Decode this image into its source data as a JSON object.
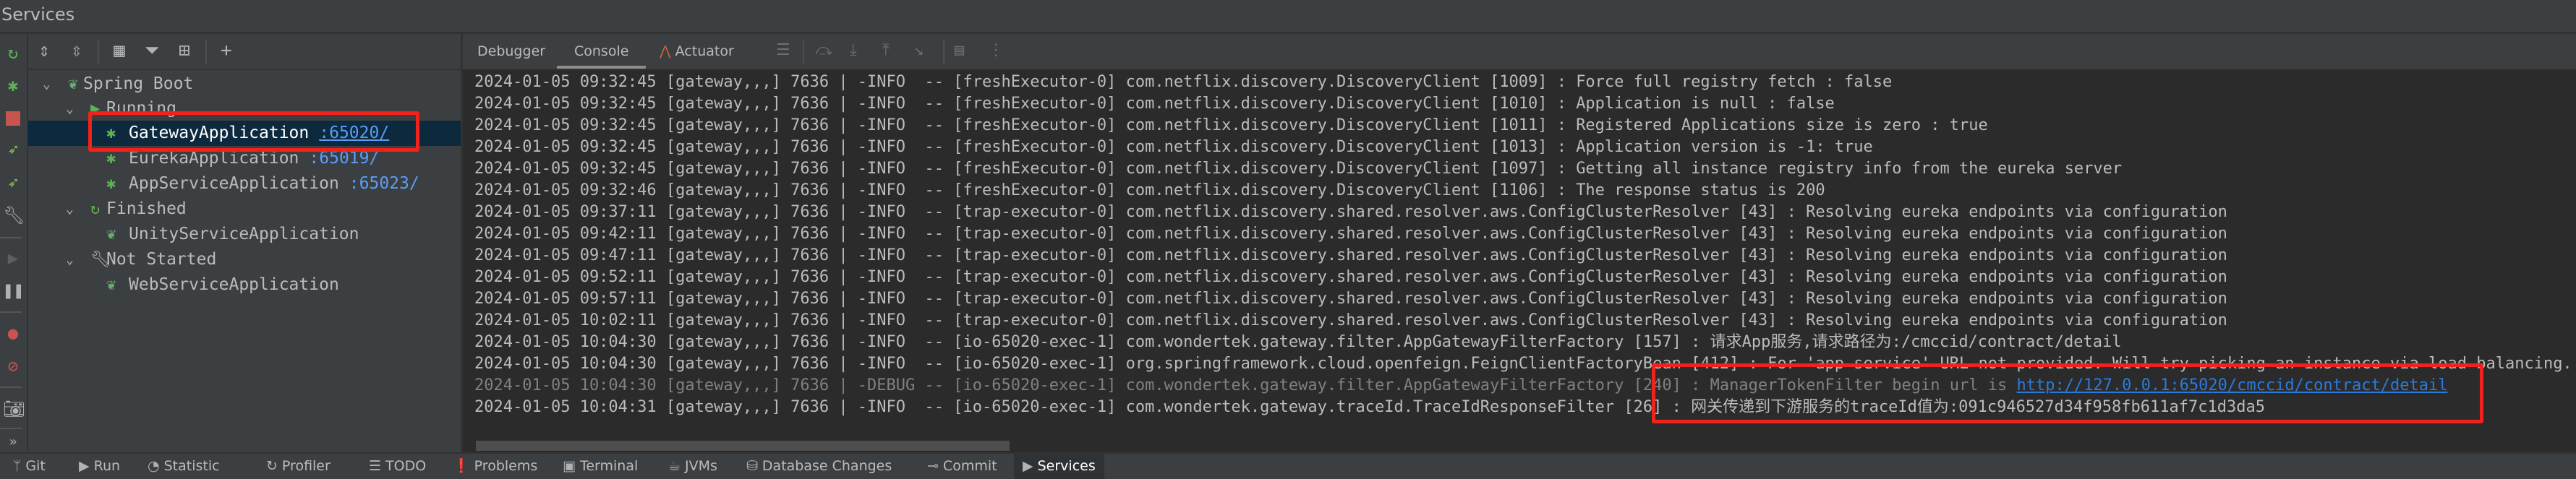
{
  "window": {
    "title": "Services"
  },
  "colors": {
    "accent_link": "#287bde",
    "port_link": "#589df6",
    "selection": "#0d293e",
    "highlight_box": "#f0221b",
    "run_green": "#5fb157",
    "stop_red": "#c75450"
  },
  "left_toolbar": {
    "icons": [
      "rerun-icon",
      "debug-icon",
      "stop-icon",
      "run-spring-icon",
      "debug-spring-icon",
      "wrench-icon",
      "resume-icon",
      "pause-icon",
      "breakpoints-icon",
      "mute-breakpoints-icon",
      "camera-icon",
      "more-icon"
    ],
    "more_label": "»"
  },
  "tree_toolbar": {
    "icons": [
      "expand-all-icon",
      "collapse-all-icon",
      "group-icon",
      "filter-icon",
      "new-tab-icon",
      "add-icon"
    ]
  },
  "tree": {
    "spring_boot": "Spring Boot",
    "running": "Running",
    "gateway": {
      "name": "GatewayApplication",
      "port": ":65020/"
    },
    "eureka": {
      "name": "EurekaApplication",
      "port": ":65019/"
    },
    "appservice": {
      "name": "AppServiceApplication",
      "port": ":65023/"
    },
    "finished": "Finished",
    "unity": "UnityServiceApplication",
    "not_started": "Not Started",
    "web": "WebServiceApplication"
  },
  "console_tabs": {
    "debugger": "Debugger",
    "console": "Console",
    "actuator": "Actuator",
    "active": "Console"
  },
  "log_lines": [
    {
      "text": "2024-01-05 09:32:45 [gateway,,,] 7636 | -INFO  -- [freshExecutor-0] com.netflix.discovery.DiscoveryClient [1009] : Force full registry fetch : false",
      "level": "INFO"
    },
    {
      "text": "2024-01-05 09:32:45 [gateway,,,] 7636 | -INFO  -- [freshExecutor-0] com.netflix.discovery.DiscoveryClient [1010] : Application is null : false",
      "level": "INFO"
    },
    {
      "text": "2024-01-05 09:32:45 [gateway,,,] 7636 | -INFO  -- [freshExecutor-0] com.netflix.discovery.DiscoveryClient [1011] : Registered Applications size is zero : true",
      "level": "INFO"
    },
    {
      "text": "2024-01-05 09:32:45 [gateway,,,] 7636 | -INFO  -- [freshExecutor-0] com.netflix.discovery.DiscoveryClient [1013] : Application version is -1: true",
      "level": "INFO"
    },
    {
      "text": "2024-01-05 09:32:45 [gateway,,,] 7636 | -INFO  -- [freshExecutor-0] com.netflix.discovery.DiscoveryClient [1097] : Getting all instance registry info from the eureka server",
      "level": "INFO"
    },
    {
      "text": "2024-01-05 09:32:46 [gateway,,,] 7636 | -INFO  -- [freshExecutor-0] com.netflix.discovery.DiscoveryClient [1106] : The response status is 200",
      "level": "INFO"
    },
    {
      "text": "2024-01-05 09:37:11 [gateway,,,] 7636 | -INFO  -- [trap-executor-0] com.netflix.discovery.shared.resolver.aws.ConfigClusterResolver [43] : Resolving eureka endpoints via configuration",
      "level": "INFO"
    },
    {
      "text": "2024-01-05 09:42:11 [gateway,,,] 7636 | -INFO  -- [trap-executor-0] com.netflix.discovery.shared.resolver.aws.ConfigClusterResolver [43] : Resolving eureka endpoints via configuration",
      "level": "INFO"
    },
    {
      "text": "2024-01-05 09:47:11 [gateway,,,] 7636 | -INFO  -- [trap-executor-0] com.netflix.discovery.shared.resolver.aws.ConfigClusterResolver [43] : Resolving eureka endpoints via configuration",
      "level": "INFO"
    },
    {
      "text": "2024-01-05 09:52:11 [gateway,,,] 7636 | -INFO  -- [trap-executor-0] com.netflix.discovery.shared.resolver.aws.ConfigClusterResolver [43] : Resolving eureka endpoints via configuration",
      "level": "INFO"
    },
    {
      "text": "2024-01-05 09:57:11 [gateway,,,] 7636 | -INFO  -- [trap-executor-0] com.netflix.discovery.shared.resolver.aws.ConfigClusterResolver [43] : Resolving eureka endpoints via configuration",
      "level": "INFO"
    },
    {
      "text": "2024-01-05 10:02:11 [gateway,,,] 7636 | -INFO  -- [trap-executor-0] com.netflix.discovery.shared.resolver.aws.ConfigClusterResolver [43] : Resolving eureka endpoints via configuration",
      "level": "INFO"
    },
    {
      "text": "2024-01-05 10:04:30 [gateway,,,] 7636 | -INFO  -- [io-65020-exec-1] com.wondertek.gateway.filter.AppGatewayFilterFactory [157] : 请求App服务,请求路径为:/cmccid/contract/detail",
      "level": "INFO"
    },
    {
      "text": "2024-01-05 10:04:30 [gateway,,,] 7636 | -INFO  -- [io-65020-exec-1] org.springframework.cloud.openfeign.FeignClientFactoryBean [412] : For 'app-service' URL not provided. Will try picking an instance via load-balancing.",
      "level": "INFO"
    },
    {
      "text": "2024-01-05 10:04:30 [gateway,,,] 7636 | -DEBUG -- [io-65020-exec-1] com.wondertek.gateway.filter.AppGatewayFilterFactory [240] : ManagerTokenFilter begin url is ",
      "level": "DEBUG",
      "link": "http://127.0.0.1:65020/cmccid/contract/detail"
    },
    {
      "text": "2024-01-05 10:04:31 [gateway,,,] 7636 | -INFO  -- [io-65020-exec-1] com.wondertek.gateway.traceId.TraceIdResponseFilter [26] : 网关传递到下游服务的traceId值为:091c946527d34f958fb611af7c1d3da5",
      "level": "INFO"
    }
  ],
  "bottom_bar": [
    {
      "label": "Git",
      "icon": "git-branch-icon",
      "glyph": "ᛘ"
    },
    {
      "label": "Run",
      "icon": "run-icon",
      "glyph": "▶"
    },
    {
      "label": "Statistic",
      "icon": "statistic-icon",
      "glyph": "◔"
    },
    {
      "label": "Profiler",
      "icon": "profiler-icon",
      "glyph": "↻"
    },
    {
      "label": "TODO",
      "icon": "todo-list-icon",
      "glyph": "☰"
    },
    {
      "label": "Problems",
      "icon": "problems-icon",
      "glyph": "❗"
    },
    {
      "label": "Terminal",
      "icon": "terminal-icon",
      "glyph": "▣"
    },
    {
      "label": "JVMs",
      "icon": "jvm-icon",
      "glyph": "☕"
    },
    {
      "label": "Database Changes",
      "icon": "database-icon",
      "glyph": "⛁"
    },
    {
      "label": "Commit",
      "icon": "commit-icon",
      "glyph": "⊸"
    },
    {
      "label": "Services",
      "icon": "services-icon",
      "glyph": "▶",
      "active": true
    }
  ]
}
